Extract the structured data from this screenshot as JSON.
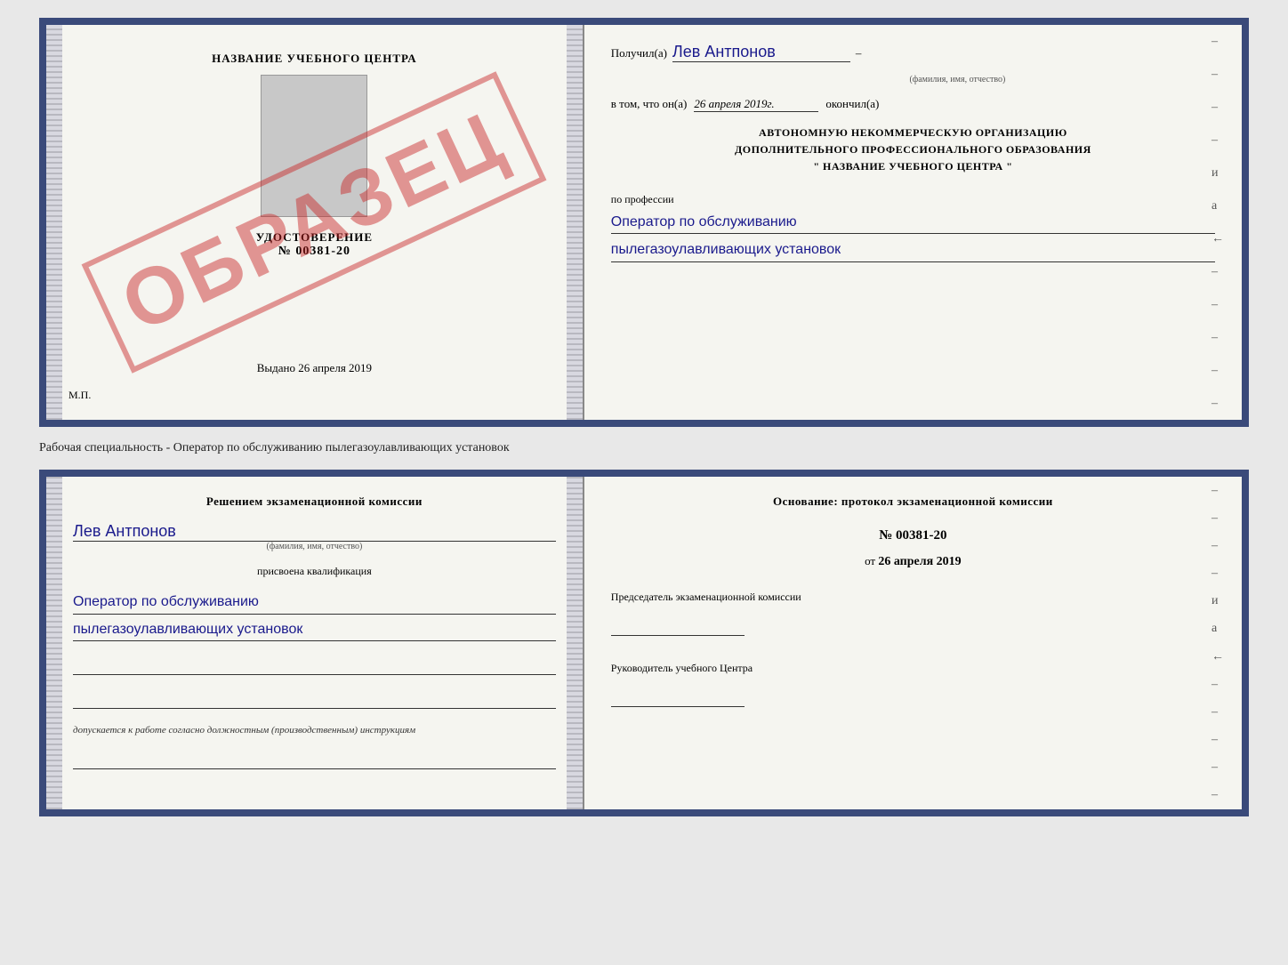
{
  "page": {
    "background": "#e8e8e8"
  },
  "top_cert": {
    "left": {
      "header": "НАЗВАНИЕ УЧЕБНОГО ЦЕНТРА",
      "doc_title": "УДОСТОВЕРЕНИЕ",
      "doc_number": "№ 00381-20",
      "issued_label": "Выдано",
      "issued_date": "26 апреля 2019",
      "mp_label": "М.П.",
      "watermark": "ОБРАЗЕЦ"
    },
    "right": {
      "received_label": "Получил(а)",
      "received_name": "Лев Антпонов",
      "fio_label": "(фамилия, имя, отчество)",
      "date_prefix": "в том, что он(а)",
      "date_value": "26 апреля 2019г.",
      "date_suffix": "окончил(а)",
      "org_line1": "АВТОНОМНУЮ НЕКОММЕРЧЕСКУЮ ОРГАНИЗАЦИЮ",
      "org_line2": "ДОПОЛНИТЕЛЬНОГО ПРОФЕССИОНАЛЬНОГО ОБРАЗОВАНИЯ",
      "org_line3": "\"    НАЗВАНИЕ УЧЕБНОГО ЦЕНТРА    \"",
      "profession_label": "по профессии",
      "profession_line1": "Оператор по обслуживанию",
      "profession_line2": "пылегазоулавливающих установок",
      "dashes": [
        "-",
        "-",
        "-",
        "-",
        "и",
        "а",
        "←",
        "-",
        "-",
        "-",
        "-",
        "-"
      ]
    }
  },
  "between_label": "Рабочая специальность - Оператор по обслуживанию пылегазоулавливающих установок",
  "bottom_cert": {
    "left": {
      "decision_label": "Решением экзаменационной комиссии",
      "person_name": "Лев Антпонов",
      "fio_label": "(фамилия, имя, отчество)",
      "qualification_label": "присвоена квалификация",
      "qualification_line1": "Оператор по обслуживанию",
      "qualification_line2": "пылегазоулавливающих установок",
      "allowed_text": "допускается к работе согласно должностным (производственным) инструкциям"
    },
    "right": {
      "basis_label": "Основание: протокол экзаменационной комиссии",
      "protocol_number": "№ 00381-20",
      "date_prefix": "от",
      "date_value": "26 апреля 2019",
      "chairman_label": "Председатель экзаменационной комиссии",
      "director_label": "Руководитель учебного Центра",
      "dashes": [
        "-",
        "-",
        "-",
        "-",
        "и",
        "а",
        "←",
        "-",
        "-",
        "-",
        "-",
        "-"
      ]
    }
  }
}
